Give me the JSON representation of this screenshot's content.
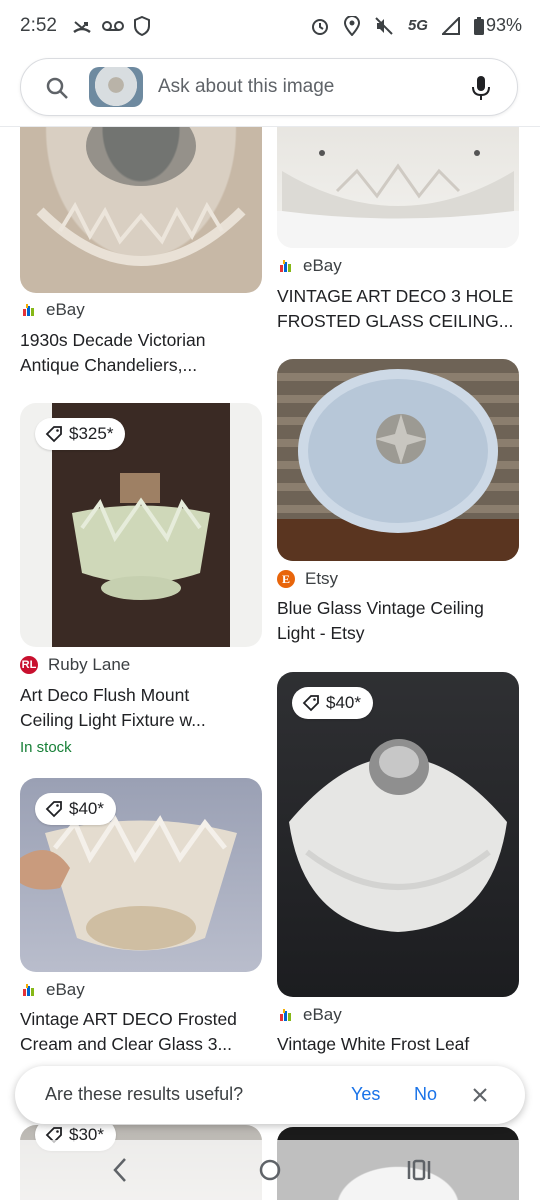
{
  "status_bar": {
    "time": "2:52",
    "network": "5G",
    "battery": "93%",
    "icons": [
      "missed-call-icon",
      "voicemail-icon",
      "shield-icon",
      "alarm-icon",
      "location-icon",
      "mute-icon",
      "signal-icon",
      "battery-icon"
    ]
  },
  "search": {
    "placeholder": "Ask about this image"
  },
  "results": [
    {
      "source": "eBay",
      "title_line1": "1930s Decade Victorian",
      "title_line2": "Antique Chandeliers,...",
      "source_icon": "ebay-icon"
    },
    {
      "source": "eBay",
      "title_line1": "VINTAGE ART DECO 3 HOLE",
      "title_line2": "FROSTED GLASS CEILING...",
      "source_icon": "ebay-icon"
    },
    {
      "price": "$325*",
      "source": "Ruby Lane",
      "title_line1": "Art Deco Flush Mount",
      "title_line2": "Ceiling Light Fixture w...",
      "status": "In stock",
      "source_icon": "ruby-lane-icon"
    },
    {
      "source": "Etsy",
      "title_line1": "Blue Glass Vintage Ceiling",
      "title_line2": "Light - Etsy",
      "source_icon": "etsy-icon"
    },
    {
      "price": "$40*",
      "source": "eBay",
      "title_line1": "Vintage ART DECO Frosted",
      "title_line2": "Cream and Clear Glass 3...",
      "source_icon": "ebay-icon"
    },
    {
      "price": "$40*",
      "source": "eBay",
      "title_line1": "Vintage White Frost Leaf",
      "source_icon": "ebay-icon"
    },
    {
      "price": "$30*"
    }
  ],
  "feedback": {
    "question": "Are these results useful?",
    "yes": "Yes",
    "no": "No"
  },
  "colors": {
    "accent": "#1a73e8",
    "in_stock": "#188038",
    "etsy": "#e8650b",
    "ruby_lane": "#c8102e"
  }
}
